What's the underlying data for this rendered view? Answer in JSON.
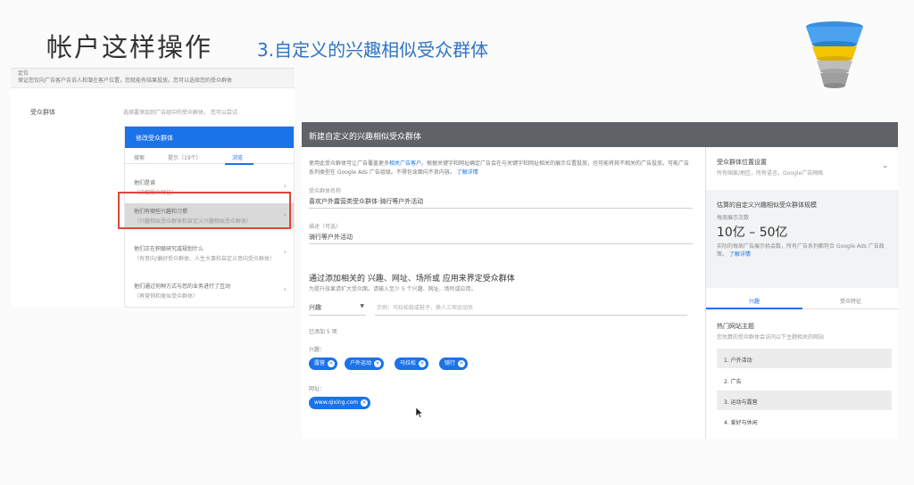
{
  "slide": {
    "title": "帐户这样操作",
    "subtitle": "3.自定义的兴趣相似受众群体"
  },
  "left_shot": {
    "top_label": "定位",
    "top_desc": "保证您仅向广告客户告诉人和潜在客户位置，您就能有结果投放。您可以选择您的受众群体",
    "row_label": "受众群体",
    "row_desc": "选择要添加到广告组中的受众群体。   您可以尝试",
    "panel_title": "修改受众群体",
    "search_placeholder": "搜索",
    "tabs": [
      "搜索",
      "提示（19个）",
      "浏览"
    ],
    "items": [
      {
        "title": "他们是谁",
        "sub": "（详细受众特征）"
      },
      {
        "title": "他们有哪些兴趣和习惯",
        "sub": "（兴趣相似受众群体和自定义兴趣相似受众群体）"
      },
      {
        "title": "他们正在积极研究或规划什么",
        "sub": "（有意向/偏好受众群体、人生大事和自定义意向受众群体）"
      },
      {
        "title": "他们通过何种方式与您的业务进行了互动",
        "sub": "（再营销和类似受众群体）"
      }
    ]
  },
  "main": {
    "header": "新建自定义的兴趣相似受众群体",
    "intro_a": "使用此受众群体可让广告覆盖更多",
    "intro_link": "相关广告客户",
    "intro_b": "。根据关键字和网址确定广告会在与关键字和网址相关的展示位置投放，也可能将其不相关的广告投放。可能广告系列类型在 Google Ads 广告组级。不得包含面向不良内容。",
    "intro_link2": "了解详情",
    "name_label": "受众群体名称",
    "name_value": "喜欢户外露营类受众群体·骑行等户外活动",
    "desc_label": "描述（可选）",
    "desc_value": "骑行等户外活动",
    "define_title": "通过添加相关的 兴趣、网址、场所或 应用来界定受众群体",
    "define_sub": "为提升效果请扩大受众面。请输入至少 5 个兴趣、网址、场所或应用。",
    "select_value": "兴趣",
    "search_placeholder": "示例：马拉松鞋或鞋子、换人三项运动员",
    "added_count": "已添加 5 项",
    "interests_label": "兴趣：",
    "interests": [
      "露营",
      "户外运动",
      "马拉松",
      "骑行"
    ],
    "urls_label": "网址：",
    "urls": [
      "www.qixing.com"
    ]
  },
  "sidebar": {
    "settings_title": "受众群体位置设置",
    "settings_sub": "所有国家/地区，所有语言，Google广告网络",
    "estimate_title": "估算的自定义兴趣相似受众群体规模",
    "impressions_label": "每周展示次数",
    "range": "10亿 – 50亿",
    "estimate_desc": "实际的每周广告展示机会数，所有广告系列都符合 Google Ads 广告政策。",
    "estimate_link": "了解详情",
    "tabs": [
      "兴趣",
      "受众特征"
    ],
    "topics_title": "热门网站主题",
    "topics_sub": "您估算的受众群体会访问以下主题相关的网站",
    "topics": [
      "1. 户外活动",
      "2. 广告",
      "3. 运动与露营",
      "4. 爱好与休闲"
    ]
  },
  "colors": {
    "accent": "#1a73e8",
    "subtitle": "#2e74c4",
    "highlight": "#e0453a",
    "header_gray": "#5f6368"
  }
}
